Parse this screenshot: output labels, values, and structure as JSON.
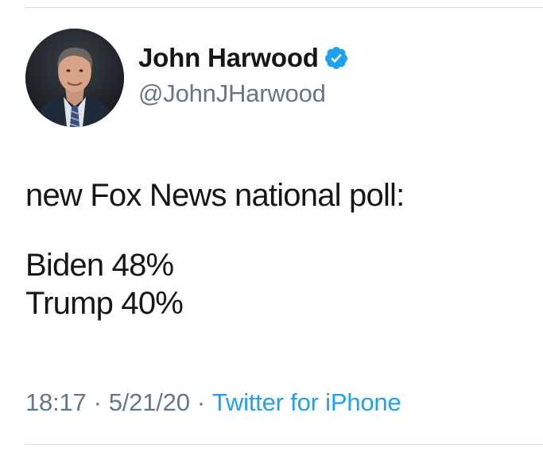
{
  "author": {
    "display_name": "John Harwood",
    "handle": "@JohnJHarwood",
    "verified": true
  },
  "tweet": {
    "lines": [
      "new Fox News national poll:",
      "Biden 48%",
      "Trump 40%"
    ]
  },
  "meta": {
    "time": "18:17",
    "separator": "·",
    "date": "5/21/20",
    "source": "Twitter for iPhone"
  },
  "colors": {
    "text": "#14171a",
    "secondary": "#657786",
    "link": "#1da1f2",
    "verified_badge": "#1da1f2",
    "divider": "#d8dde1"
  },
  "icons": {
    "verified": "verified-badge-icon",
    "avatar": "profile-photo"
  }
}
